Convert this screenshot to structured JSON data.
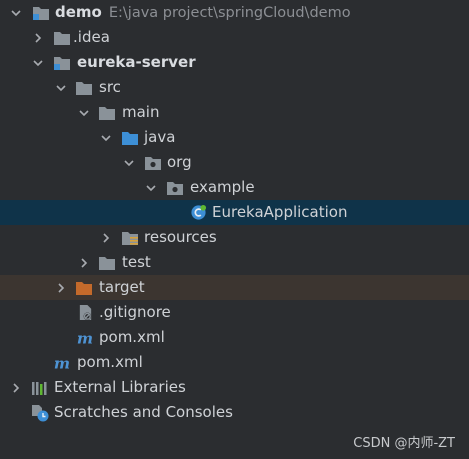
{
  "tree": {
    "root": {
      "name": "demo",
      "path": "E:\\java project\\springCloud\\demo"
    },
    "idea": "idea",
    "idea_dot": ".",
    "eureka_server": "eureka-server",
    "src": "src",
    "main": "main",
    "java": "java",
    "org": "org",
    "example": "example",
    "eureka_application": "EurekaApplication",
    "resources": "resources",
    "test": "test",
    "target": "target",
    "gitignore": ".gitignore",
    "pom_module": "pom.xml",
    "pom_root": "pom.xml",
    "external_libraries": "External Libraries",
    "scratches": "Scratches and Consoles"
  },
  "watermark": "CSDN @内师-ZT",
  "colors": {
    "background": "#2b2d30",
    "selection": "#0f3349",
    "excluded": "#3c3530",
    "folder": "#8a9299",
    "source_folder": "#3d8fd6",
    "target_folder": "#c46a2b",
    "maven": "#4e93d3"
  },
  "icons": {
    "expanded": "chevron-down-icon",
    "collapsed": "chevron-right-icon",
    "folder": "folder-icon",
    "module": "module-folder-icon",
    "package": "package-icon",
    "spring_class": "spring-boot-class-icon",
    "maven": "maven-icon",
    "libraries": "libraries-icon",
    "scratches": "scratches-icon"
  }
}
